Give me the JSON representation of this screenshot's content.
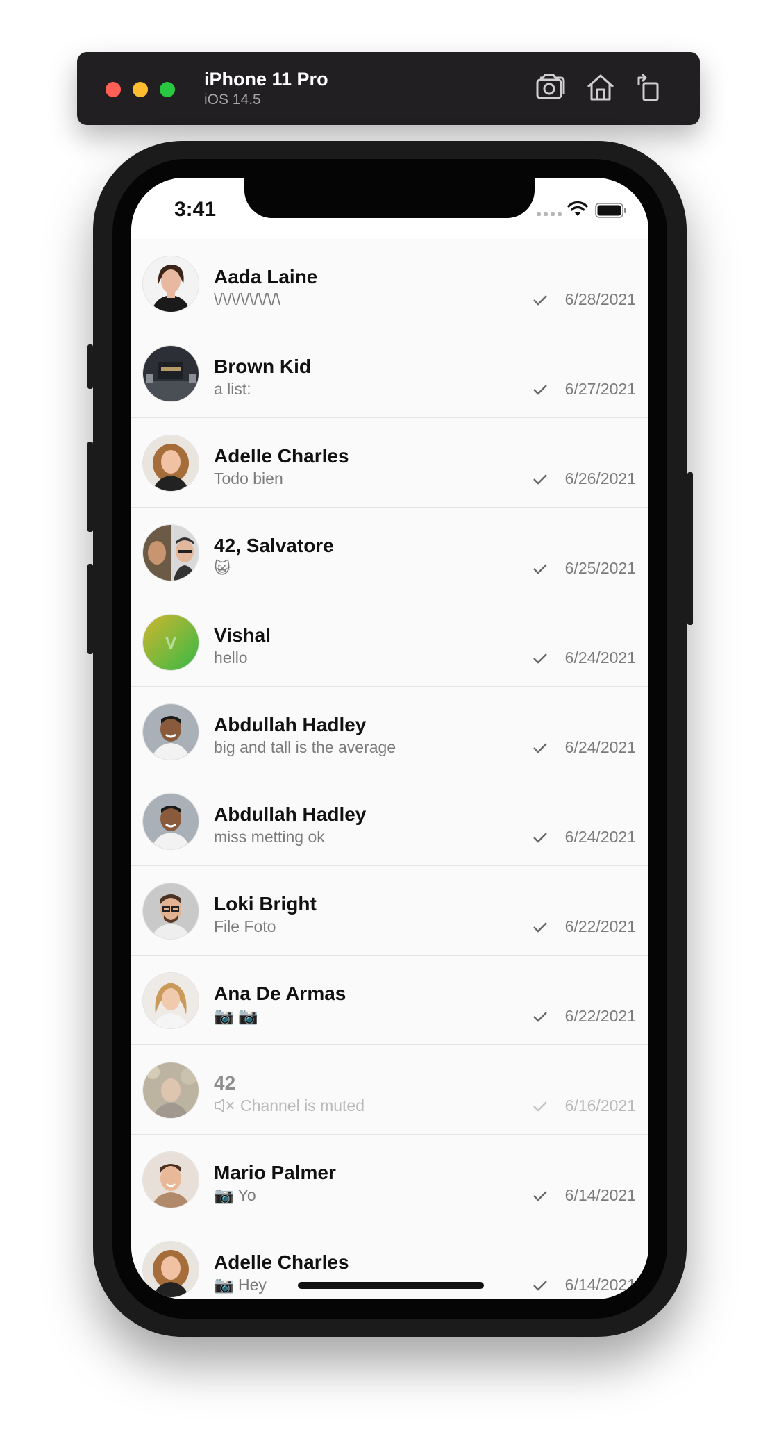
{
  "simulator": {
    "device_name": "iPhone 11 Pro",
    "os_version": "iOS 14.5",
    "icons": [
      "screenshot-icon",
      "home-icon",
      "rotate-icon"
    ]
  },
  "status_bar": {
    "time": "3:41"
  },
  "conversations": [
    {
      "name": "Aada Laine",
      "preview": "\\/\\/\\/\\/\\/\\/\\/\\",
      "date": "6/28/2021",
      "avatar": "photo-woman-dark-hair"
    },
    {
      "name": "Brown Kid",
      "preview": "a list:",
      "date": "6/27/2021",
      "avatar": "photo-storefront"
    },
    {
      "name": "Adelle Charles",
      "preview": "Todo bien",
      "date": "6/26/2021",
      "avatar": "photo-woman-curly-hair"
    },
    {
      "name": "42, Salvatore",
      "preview": "😺",
      "date": "6/25/2021",
      "avatar": "photo-two-men"
    },
    {
      "name": "Vishal",
      "preview": "hello",
      "date": "6/24/2021",
      "avatar": "initial",
      "initial": "V"
    },
    {
      "name": "Abdullah Hadley",
      "preview": "big and tall is the average",
      "date": "6/24/2021",
      "avatar": "photo-smiling-man"
    },
    {
      "name": "Abdullah Hadley",
      "preview": "miss metting ok",
      "date": "6/24/2021",
      "avatar": "photo-smiling-man"
    },
    {
      "name": "Loki Bright",
      "preview": "File Foto",
      "date": "6/22/2021",
      "avatar": "photo-man-glasses"
    },
    {
      "name": "Ana De Armas",
      "preview": "📷 📷",
      "date": "6/22/2021",
      "avatar": "photo-woman-blonde"
    },
    {
      "name": "42",
      "preview": "Channel is muted",
      "date": "6/16/2021",
      "avatar": "photo-man-outdoor",
      "muted": true
    },
    {
      "name": "Mario Palmer",
      "preview": "📷 Yo",
      "date": "6/14/2021",
      "avatar": "photo-man-smile"
    },
    {
      "name": "Adelle Charles",
      "preview": "📷 Hey",
      "date": "6/14/2021",
      "avatar": "photo-woman-curly-hair"
    }
  ],
  "colors": {
    "accent_vishal_gradient": [
      "#c7b531",
      "#3dba46"
    ],
    "text_primary": "#111111",
    "text_secondary": "#7b7b7b"
  }
}
